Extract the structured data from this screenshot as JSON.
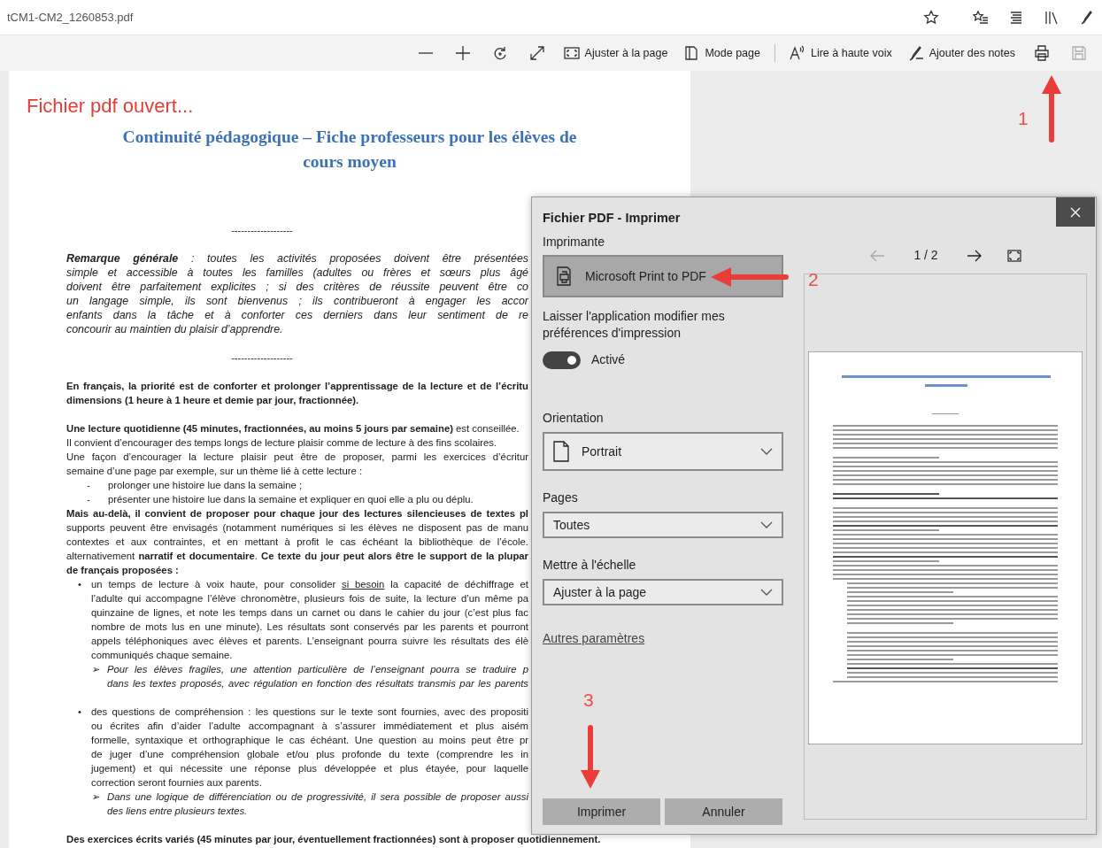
{
  "address_bar": {
    "url": "tCM1-CM2_1260853.pdf"
  },
  "pdf_toolbar": {
    "items": [
      {
        "kind": "icon",
        "disabled": false
      },
      {
        "kind": "icon",
        "disabled": false
      },
      {
        "kind": "icon",
        "disabled": false
      },
      {
        "kind": "icon",
        "disabled": false
      },
      {
        "kind": "labelled",
        "label": "Ajuster à la page",
        "disabled": false
      },
      {
        "kind": "labelled",
        "label": "Mode page",
        "disabled": false
      },
      {
        "kind": "divider"
      },
      {
        "kind": "labelled",
        "label": "Lire à haute voix",
        "disabled": false
      },
      {
        "kind": "labelled",
        "label": "Ajouter des notes",
        "disabled": false
      },
      {
        "kind": "icon",
        "disabled": false
      },
      {
        "kind": "icon",
        "disabled": true
      }
    ]
  },
  "annotations": [
    {
      "kind": "caption",
      "text": "Fichier pdf ouvert..."
    },
    {
      "kind": "step",
      "text": "1"
    },
    {
      "kind": "step",
      "text": "2"
    },
    {
      "kind": "step",
      "text": "3"
    }
  ],
  "document": {
    "blocks": [
      {
        "kind": "title",
        "text": "Continuité pédagogique – Fiche professeurs pour les élèves de cours moyen"
      },
      {
        "kind": "separator",
        "text": "-------------------"
      },
      {
        "kind": "remark",
        "lines": [
          {
            "kind": "plain",
            "bold": false,
            "justified": true,
            "text": "**Remarque générale** : toutes les activités proposées doivent être présentées"
          },
          {
            "kind": "plain",
            "bold": false,
            "justified": true,
            "text": "simple et accessible à toutes les familles (adultes ou frères et sœurs plus âgé"
          },
          {
            "kind": "plain",
            "bold": false,
            "justified": true,
            "text": "doivent être parfaitement explicites ; si des critères de réussite peuvent être co"
          },
          {
            "kind": "plain",
            "bold": false,
            "justified": true,
            "text": "un langage simple, ils sont bienvenus ; ils contribueront à engager les accor"
          },
          {
            "kind": "plain",
            "bold": false,
            "justified": true,
            "text": "enfants dans la tâche et à conforter ces derniers dans leur sentiment de re"
          },
          {
            "kind": "plain",
            "bold": false,
            "justified": false,
            "text": "concourir au maintien du plaisir d’apprendre."
          }
        ]
      },
      {
        "kind": "separator",
        "text": "-------------------"
      },
      {
        "kind": "body",
        "lines": [
          {
            "kind": "plain",
            "bold": true,
            "justified": true,
            "text": "En français, la priorité est de conforter et prolonger l’apprentissage de la lecture et de l’écritu"
          },
          {
            "kind": "plain",
            "bold": true,
            "justified": false,
            "text": "dimensions (1 heure à 1 heure et demie par jour, fractionnée)."
          }
        ]
      },
      {
        "kind": "body",
        "lines": [
          {
            "kind": "plain",
            "bold": false,
            "justified": false,
            "text": "**Une lecture quotidienne (45 minutes, fractionnées, au moins 5 jours par semaine)** est conseillée."
          },
          {
            "kind": "plain",
            "bold": false,
            "justified": false,
            "text": "Il convient d’encourager des temps longs de lecture plaisir comme de lecture à des fins scolaires."
          },
          {
            "kind": "plain",
            "bold": false,
            "justified": true,
            "text": "Une façon d’encourager la lecture plaisir peut être de proposer, parmi les exercices d’écritur"
          },
          {
            "kind": "plain",
            "bold": false,
            "justified": false,
            "text": "semaine d’une page par exemple, sur un thème lié à cette lecture :"
          },
          {
            "kind": "dash",
            "marker": "-",
            "bold": false,
            "justified": false,
            "text": "prolonger une histoire lue dans la semaine ;"
          },
          {
            "kind": "dash",
            "marker": "-",
            "bold": false,
            "justified": false,
            "text": "présenter une histoire lue dans la semaine et expliquer en quoi elle a plu ou déplu."
          },
          {
            "kind": "plain",
            "bold": true,
            "justified": true,
            "text": "Mais au-delà, il convient de proposer pour chaque jour des lectures silencieuses de textes pl"
          },
          {
            "kind": "plain",
            "bold": false,
            "justified": true,
            "text": "supports peuvent être envisagés (notamment numériques si les élèves ne disposent pas de manu"
          },
          {
            "kind": "plain",
            "bold": false,
            "justified": true,
            "text": "contextes et aux contraintes, et en mettant à profit le cas échéant la bibliothèque de l’école."
          },
          {
            "kind": "plain",
            "bold": false,
            "justified": true,
            "text": "alternativement **narratif et documentaire**. **Ce texte du jour peut alors être le support de la plupar**"
          },
          {
            "kind": "plain",
            "bold": true,
            "justified": false,
            "text": "de français proposées :"
          },
          {
            "kind": "bullet",
            "marker": "•",
            "bold": false,
            "justified": true,
            "segments": [
              {
                "text": "un temps de lecture à voix haute, pour consolider ",
                "underline": false
              },
              {
                "text": "si besoin",
                "underline": true
              },
              {
                "text": " la capacité de déchiffrage et",
                "underline": false
              }
            ]
          },
          {
            "kind": "bullet-cont",
            "bold": false,
            "justified": true,
            "text": "l’adulte qui accompagne l’élève chronomètre, plusieurs fois de suite, la lecture d’un même pa"
          },
          {
            "kind": "bullet-cont",
            "bold": false,
            "justified": true,
            "text": "quinzaine de lignes, et note les temps dans un carnet ou dans le cahier du jour (c’est plus fac"
          },
          {
            "kind": "bullet-cont",
            "bold": false,
            "justified": true,
            "text": "nombre de mots lus en une minute). Les résultats sont conservés par les parents et pourront"
          },
          {
            "kind": "bullet-cont",
            "bold": false,
            "justified": true,
            "text": "appels téléphoniques avec élèves et parents. L’enseignant pourra suivre les résultats des élè"
          },
          {
            "kind": "bullet-cont",
            "bold": false,
            "justified": false,
            "text": "communiqués chaque semaine."
          },
          {
            "kind": "arrow",
            "marker": "➢",
            "bold": false,
            "justified": true,
            "text": "Pour les élèves fragiles, une attention particulière de l’enseignant pourra se traduire p"
          },
          {
            "kind": "arrow-cont",
            "bold": false,
            "justified": true,
            "text": "dans les textes proposés, avec régulation en fonction des résultats transmis par les parents"
          }
        ]
      },
      {
        "kind": "body",
        "lines": [
          {
            "kind": "bullet",
            "marker": "•",
            "bold": false,
            "justified": true,
            "text": "des questions de compréhension : les questions sur le texte sont fournies, avec des propositi"
          },
          {
            "kind": "bullet-cont",
            "bold": false,
            "justified": true,
            "text": "ou écrites afin d’aider l’adulte accompagnant à s’assurer immédiatement et plus aisém"
          },
          {
            "kind": "bullet-cont",
            "bold": false,
            "justified": true,
            "text": "formelle, syntaxique et orthographique le cas échéant. Une question au moins peut être pr"
          },
          {
            "kind": "bullet-cont",
            "bold": false,
            "justified": true,
            "text": "de juger d’une compréhension globale et/ou plus profonde du texte (comprendre les in"
          },
          {
            "kind": "bullet-cont",
            "bold": false,
            "justified": true,
            "text": "jugement) et qui nécessite une réponse plus développée et plus étayée, pour laquelle"
          },
          {
            "kind": "bullet-cont",
            "bold": false,
            "justified": false,
            "text": "correction seront fournies aux parents."
          },
          {
            "kind": "arrow",
            "marker": "➢",
            "bold": false,
            "justified": true,
            "text": "Dans une logique de différenciation ou de progressivité, il sera possible de proposer aussi"
          },
          {
            "kind": "arrow-cont",
            "bold": false,
            "justified": false,
            "text": "des liens entre plusieurs textes."
          }
        ]
      },
      {
        "kind": "body",
        "lines": [
          {
            "kind": "plain",
            "bold": true,
            "justified": false,
            "text": "Des exercices écrits variés (45 minutes par jour, éventuellement fractionnées) sont à proposer quotidiennement."
          }
        ]
      }
    ]
  },
  "print_dialog": {
    "title": "Fichier PDF - Imprimer",
    "printer": {
      "label": "Imprimante",
      "value": "Microsoft Print to PDF"
    },
    "app_prefs": {
      "label": "Laisser l'application modifier mes préférences d'impression",
      "on": true,
      "state_text": "Activé"
    },
    "fields": [
      {
        "kind": "orientation",
        "label": "Orientation",
        "value": "Portrait"
      },
      {
        "kind": "plain",
        "label": "Pages",
        "value": "Toutes"
      },
      {
        "kind": "plain",
        "label": "Mettre à l'échelle",
        "value": "Ajuster à la page"
      }
    ],
    "more_link": "Autres paramètres",
    "buttons": [
      "Imprimer",
      "Annuler"
    ],
    "preview": {
      "page_indicator": "1 / 2",
      "prev": {
        "disabled": true
      },
      "next": {
        "disabled": false
      }
    }
  }
}
